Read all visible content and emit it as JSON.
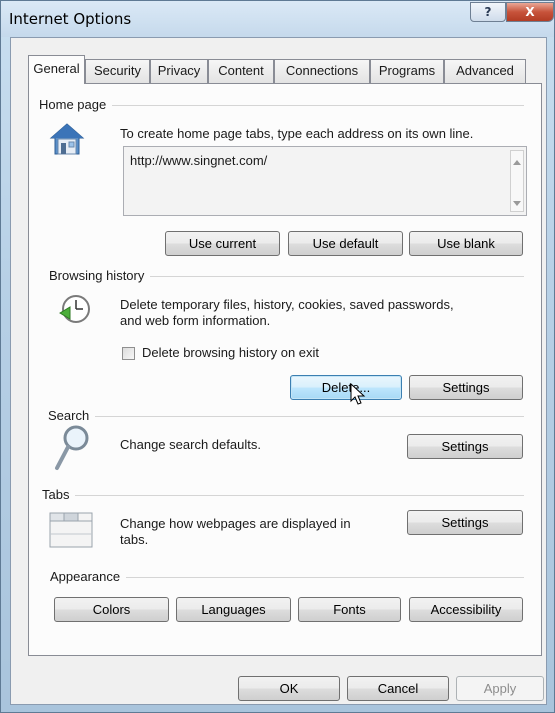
{
  "window": {
    "title": "Internet Options",
    "help_label": "?",
    "close_label": "X"
  },
  "tabs": [
    {
      "label": "General",
      "active": true
    },
    {
      "label": "Security"
    },
    {
      "label": "Privacy"
    },
    {
      "label": "Content"
    },
    {
      "label": "Connections"
    },
    {
      "label": "Programs"
    },
    {
      "label": "Advanced"
    }
  ],
  "home_page": {
    "group_label": "Home page",
    "description": "To create home page tabs, type each address on its own line.",
    "address": "http://www.singnet.com/",
    "buttons": {
      "use_current": "Use current",
      "use_default": "Use default",
      "use_blank": "Use blank"
    }
  },
  "browsing_history": {
    "group_label": "Browsing history",
    "description_line1": "Delete temporary files, history, cookies, saved passwords,",
    "description_line2": "and web form information.",
    "checkbox_label": "Delete browsing history on exit",
    "checkbox_checked": false,
    "buttons": {
      "delete": "Delete...",
      "settings": "Settings"
    }
  },
  "search": {
    "group_label": "Search",
    "description": "Change search defaults.",
    "settings_label": "Settings"
  },
  "tabs_group": {
    "group_label": "Tabs",
    "description_line1": "Change how webpages are displayed in",
    "description_line2": "tabs.",
    "settings_label": "Settings"
  },
  "appearance": {
    "group_label": "Appearance",
    "buttons": {
      "colors": "Colors",
      "languages": "Languages",
      "fonts": "Fonts",
      "accessibility": "Accessibility"
    }
  },
  "footer": {
    "ok": "OK",
    "cancel": "Cancel",
    "apply": "Apply"
  }
}
